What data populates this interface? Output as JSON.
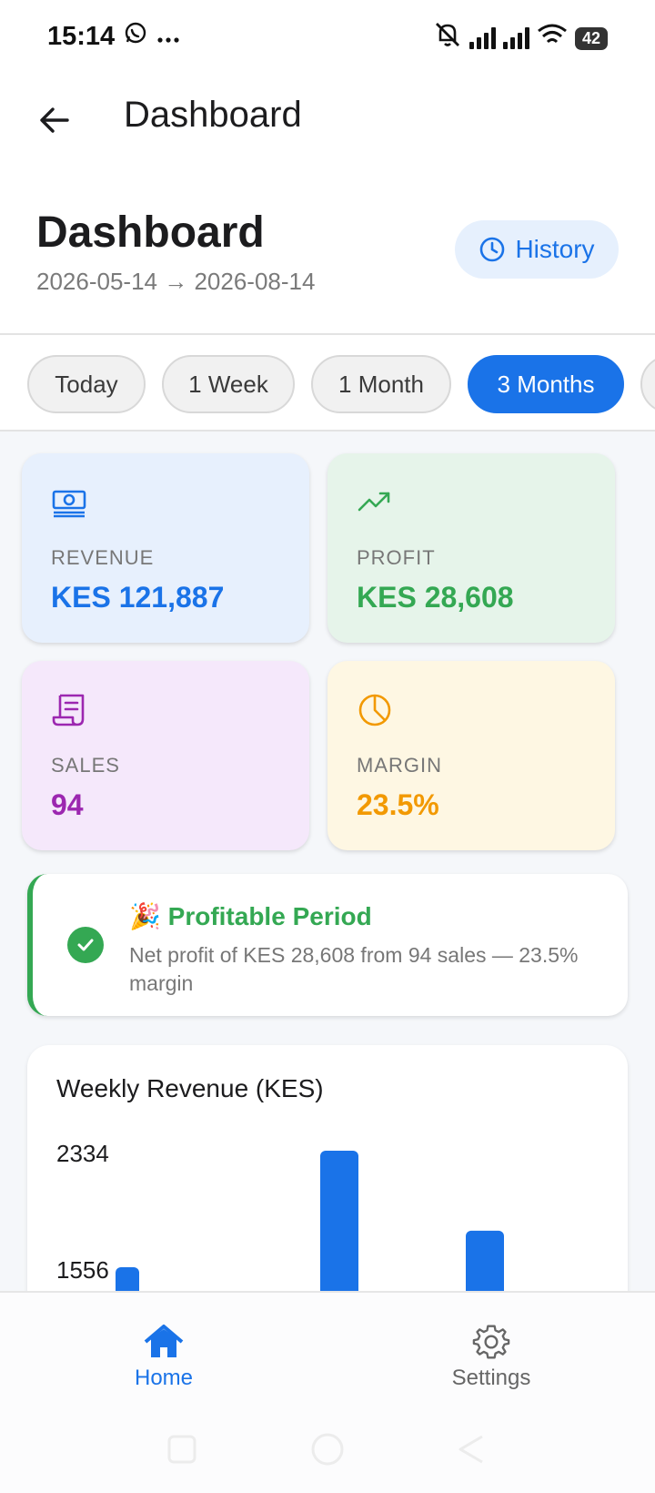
{
  "status_bar": {
    "time": "15:14",
    "battery": "42",
    "icons": [
      "whatsapp-icon",
      "more-icon",
      "mute-icon",
      "signal-icon",
      "signal-icon",
      "wifi-icon",
      "battery-icon"
    ]
  },
  "app_bar": {
    "back_icon": "arrow-left-icon",
    "title": "Dashboard"
  },
  "header": {
    "title": "Dashboard",
    "date_range": "2026-05-14 → 2026-08-14",
    "history_label": "History",
    "history_icon": "clock-icon"
  },
  "period_chips": [
    {
      "label": "Today",
      "active": false
    },
    {
      "label": "1 Week",
      "active": false
    },
    {
      "label": "1 Month",
      "active": false
    },
    {
      "label": "3 Months",
      "active": true
    }
  ],
  "stats": {
    "revenue": {
      "label": "REVENUE",
      "value": "KES 121,887",
      "icon": "cash-icon",
      "color": "#1a73e8",
      "bg": "#e7f0fd"
    },
    "profit": {
      "label": "PROFIT",
      "value": "KES 28,608",
      "icon": "trending-up-icon",
      "color": "#34a853",
      "bg": "#e6f4ea"
    },
    "sales": {
      "label": "SALES",
      "value": "94",
      "icon": "receipt-icon",
      "color": "#9c27b0",
      "bg": "#f5e8fb"
    },
    "margin": {
      "label": "MARGIN",
      "value": "23.5%",
      "icon": "pie-chart-icon",
      "color": "#f29900",
      "bg": "#fef7e3"
    }
  },
  "banner": {
    "emoji": "🎉",
    "title": "Profitable Period",
    "text": "Net profit of KES 28,608 from 94 sales — 23.5% margin",
    "icon": "check-circle-icon",
    "color": "#34a853"
  },
  "chart_data": {
    "type": "bar",
    "title": "Weekly Revenue (KES)",
    "y_tick_labels": [
      "2334",
      "1556"
    ],
    "values": [
      1556,
      2334,
      1800
    ],
    "color": "#1a73e8"
  },
  "bottom_nav": [
    {
      "label": "Home",
      "icon": "home-icon",
      "active": true
    },
    {
      "label": "Settings",
      "icon": "gear-icon",
      "active": false
    }
  ],
  "colors": {
    "accent": "#1a73e8",
    "success": "#34a853"
  }
}
